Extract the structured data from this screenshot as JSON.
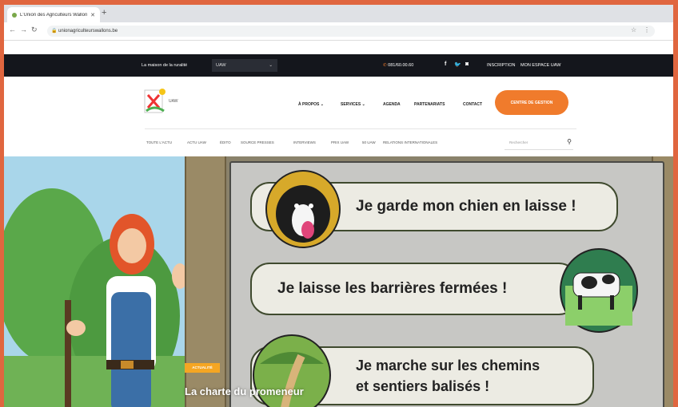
{
  "browser": {
    "tab_title": "L'Union des Agriculteurs Wallons",
    "url": "unionagriculteurswallons.be"
  },
  "topbar": {
    "tagline": "La maison de la ruralité",
    "select_value": "UAW",
    "phone": "081/60.00.60",
    "inscription": "INSCRIPTION",
    "espace": "MON ESPACE UAW"
  },
  "header": {
    "logo_text": "UAW",
    "nav": [
      "À PROPOS ⌄",
      "SERVICES ⌄",
      "AGENDA",
      "PARTENARIATS",
      "CONTACT"
    ],
    "cta": "CENTRE DE GESTION"
  },
  "subnav": {
    "items": [
      "TOUTE L'ACTU",
      "ACTU UAW",
      "ÉDITO",
      "SOURCE PRESSES",
      "INTERVIEWS",
      "PRIX UAW",
      "50 UAW",
      "RELATIONS INTERNATIONALES"
    ],
    "search_placeholder": "Rechercher"
  },
  "hero": {
    "pills": [
      "Je garde mon chien en laisse !",
      "Je laisse les barrières fermées !",
      "Je marche sur les chemins",
      "et sentiers balisés !"
    ],
    "badge": "ACTUALITÉ",
    "title": "La charte du promeneur"
  },
  "colors": {
    "accent": "#f07b2c",
    "frame": "#e0663f",
    "topbar": "#14161c"
  }
}
